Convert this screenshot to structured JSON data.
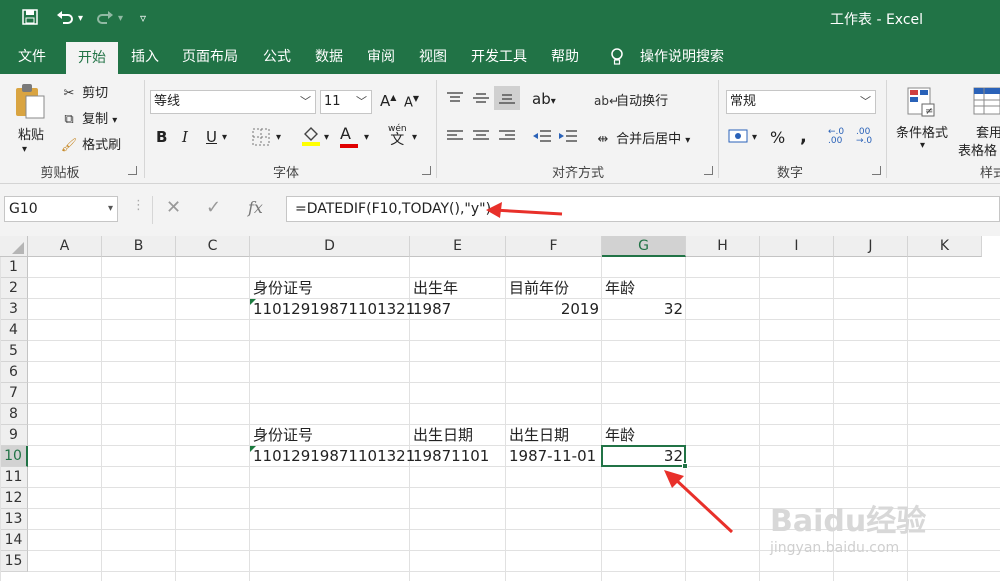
{
  "app": {
    "title": "工作表  -  Excel",
    "quick_access": {
      "save_icon": "save-icon",
      "undo_icon": "undo-icon",
      "redo_icon": "redo-icon",
      "customize_icon": "customize-icon"
    }
  },
  "tabs": [
    "文件",
    "开始",
    "插入",
    "页面布局",
    "公式",
    "数据",
    "审阅",
    "视图",
    "开发工具",
    "帮助",
    "操作说明搜索"
  ],
  "active_tab": "开始",
  "ribbon": {
    "clipboard": {
      "paste": "粘贴",
      "cut": "剪切",
      "copy": "复制",
      "format_painter": "格式刷",
      "label": "剪贴板"
    },
    "font": {
      "font_name": "等线",
      "font_size": "11",
      "bold": "B",
      "italic": "I",
      "underline": "U",
      "font_color": "A",
      "phonetic": "wén",
      "phonetic_sub": "文",
      "label": "字体"
    },
    "alignment": {
      "wrap_text": "自动换行",
      "merge_center": "合并后居中",
      "label": "对齐方式"
    },
    "number": {
      "format": "常规",
      "percent": "%",
      "comma": ",",
      "inc_decimal": ".0→.00",
      "dec_decimal": ".00→.0",
      "label": "数字"
    },
    "styles": {
      "conditional_format": "条件格式",
      "table_format_1": "套用",
      "table_format_2": "表格格",
      "label": "样式"
    }
  },
  "formula_bar": {
    "name_box": "G10",
    "formula": "=DATEDIF(F10,TODAY(),\"y\")",
    "fx": "fx"
  },
  "grid": {
    "columns": [
      "A",
      "B",
      "C",
      "D",
      "E",
      "F",
      "G",
      "H",
      "I",
      "J",
      "K"
    ],
    "rows": [
      "1",
      "2",
      "3",
      "4",
      "5",
      "6",
      "7",
      "8",
      "9",
      "10",
      "11",
      "12",
      "13",
      "14",
      "15"
    ],
    "selected_cell": "G10",
    "cells": {
      "D2": "身份证号",
      "E2": "出生年",
      "F2": "目前年份",
      "G2": "年龄",
      "D3": "11012919871101321",
      "E3": "1987",
      "F3": "2019",
      "G3": "32",
      "D9": "身份证号",
      "E9": "出生日期",
      "F9": "出生日期",
      "G9": "年龄",
      "D10": "11012919871101321",
      "E10": "19871101",
      "F10": "1987-11-01",
      "G10": "32"
    }
  },
  "watermark": {
    "brand": "Baidu经验",
    "url": "jingyan.baidu.com"
  },
  "colors": {
    "excel_green": "#217346",
    "annotation_red": "#e8302a"
  }
}
